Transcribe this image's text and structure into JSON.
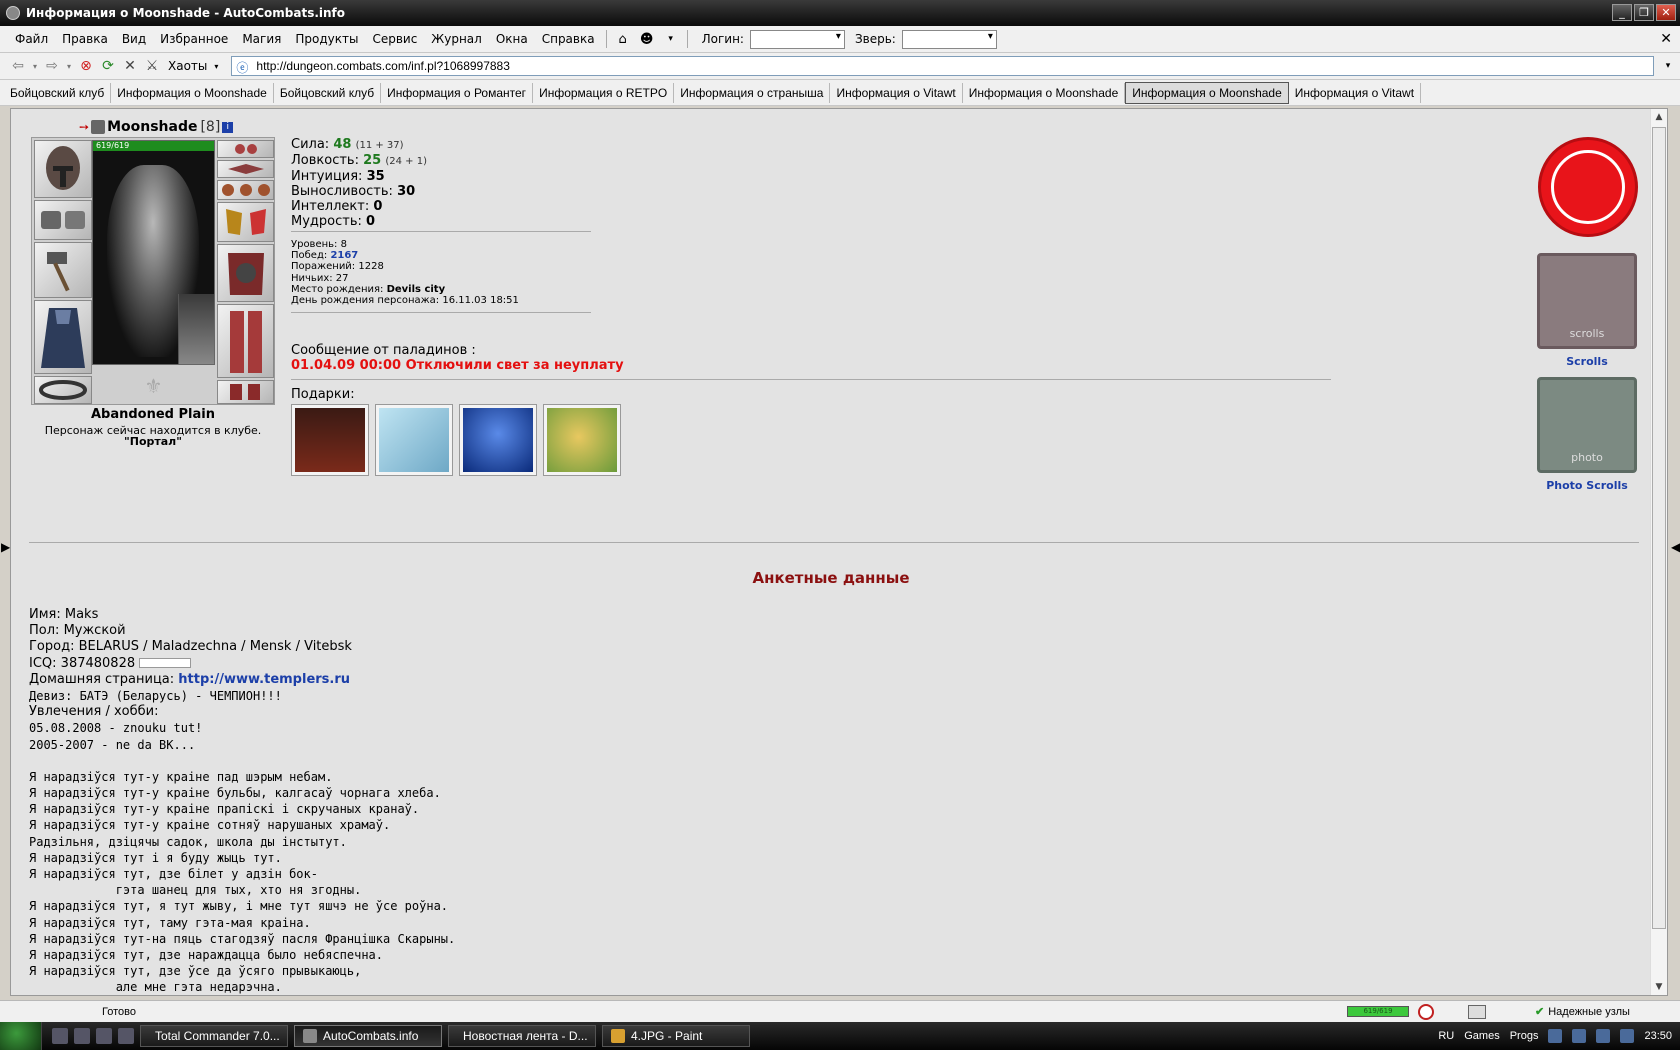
{
  "window": {
    "title": "Информация о Moonshade - AutoCombats.info"
  },
  "menu": {
    "items": [
      "Файл",
      "Правка",
      "Вид",
      "Избранное",
      "Магия",
      "Продукты",
      "Сервис",
      "Журнал",
      "Окна",
      "Справка"
    ],
    "login_label": "Логин:",
    "beast_label": "Зверь:"
  },
  "toolbar": {
    "chaos_label": "Хаоты"
  },
  "address": {
    "url": "http://dungeon.combats.com/inf.pl?1068997883"
  },
  "tabs": [
    "Бойцовский клуб",
    "Информация о Moonshade",
    "Бойцовский клуб",
    "Информация о Романтег",
    "Информация о RETPO",
    "Информация о страныша",
    "Информация о Vitawt",
    "Информация о Moonshade",
    "Информация о Moonshade",
    "Информация о Vitawt"
  ],
  "character": {
    "name": "Moonshade",
    "level": "[8]",
    "hp": "619/619",
    "location": "Abandoned Plain",
    "location_sub": "Персонаж сейчас находится в клубе.",
    "club": "\"Портал\""
  },
  "stats": [
    {
      "label": "Сила:",
      "value": "48",
      "bonus": "(11 + 37)",
      "green": true
    },
    {
      "label": "Ловкость:",
      "value": "25",
      "bonus": "(24 + 1)",
      "green": true
    },
    {
      "label": "Интуиция:",
      "value": "35",
      "bonus": "",
      "green": false
    },
    {
      "label": "Выносливость:",
      "value": "30",
      "bonus": "",
      "green": false
    },
    {
      "label": "Интеллект:",
      "value": "0",
      "bonus": "",
      "green": false
    },
    {
      "label": "Мудрость:",
      "value": "0",
      "bonus": "",
      "green": false
    }
  ],
  "meta": {
    "level_label": "Уровень:",
    "level_value": "8",
    "wins_label": "Побед:",
    "wins_value": "2167",
    "losses_label": "Поражений:",
    "losses_value": "1228",
    "draws_label": "Ничьих:",
    "draws_value": "27",
    "birthplace_label": "Место рождения:",
    "birthplace_value": "Devils city",
    "birthday_label": "День рождения персонажа:",
    "birthday_value": "16.11.03 18:51"
  },
  "paladin": {
    "title": "Сообщение от паладинов :",
    "message": "01.04.09 00:00 Отключили свет за неуплату"
  },
  "gifts": {
    "title": "Подарки:"
  },
  "clan": {
    "scrolls_label": "Scrolls",
    "photo_label": "Photo Scrolls",
    "scrolls_banner": "scrolls",
    "photo_banner": "photo"
  },
  "anketa": {
    "title": "Анкетные данные",
    "name_label": "Имя:",
    "name_value": "Maks",
    "sex_label": "Пол:",
    "sex_value": "Мужской",
    "city_label": "Город:",
    "city_value": "BELARUS / Maladzechna / Mensk / Vitebsk",
    "icq_label": "ICQ:",
    "icq_value": "387480828",
    "home_label": "Домашняя страница:",
    "home_value": "http://www.templers.ru",
    "motto": "Девиз: БАТЭ (Беларусь) - ЧЕМПИОН!!!",
    "hobby_label": "Увлечения / хобби:",
    "hobby_lines": [
      "05.08.2008 - znouku tut!",
      "2005-2007 - ne da BK...",
      "",
      "Я нарадзіўся тут-у краіне пад шэрым небам.",
      "Я нарадзіўся тут-у краіне бульбы, калгасаў чорнага хлеба.",
      "Я нарадзіўся тут-у краіне прапіскі і скручаных кранаў.",
      "Я нарадзіўся тут-у краіне сотняў нарушаных храмаў.",
      "Радзільня, дзіцячы садок, школа ды інстытут.",
      "Я нарадзіўся тут і я буду жыць тут.",
      "Я нарадзіўся тут, дзе білет у адзін бок-",
      "            гэта шанец для тых, хто ня згодны.",
      "Я нарадзіўся тут, я тут жыву, і мне тут яшчэ не ўсе роўна.",
      "Я нарадзіўся тут, таму гэта-мая краіна.",
      "Я нарадзіўся тут-на пяць стагодзяў пасля Францішка Скарыны.",
      "Я нарадзіўся тут, дзе нараждацца было небяспечна.",
      "Я нарадзіўся тут, дзе ўсе да ўсяго прывыкаюць,",
      "            але мне гэта недарэчна."
    ]
  },
  "status": {
    "ready": "Готово",
    "mini_hp": "619/619",
    "trusted": "Надежные узлы"
  },
  "taskbar": {
    "tasks": [
      "Total Commander 7.0...",
      "AutoCombats.info",
      "Новостная лента - D...",
      "4.JPG - Paint"
    ],
    "lang": "RU",
    "games": "Games",
    "progs": "Progs",
    "time": "23:50"
  },
  "colors": {
    "accent_red": "#e41010",
    "link_blue": "#1c3fa8",
    "title_dark_red": "#8b1010",
    "stat_green": "#1f7a1f"
  }
}
